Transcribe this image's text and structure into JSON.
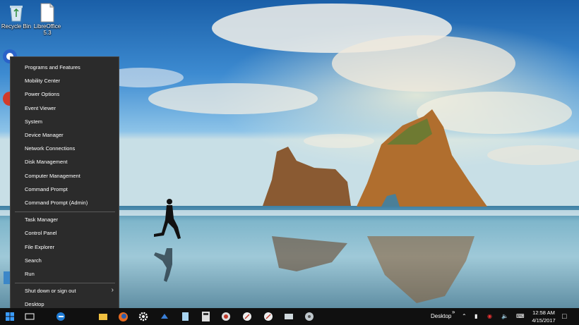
{
  "desktop": {
    "icons": [
      {
        "label": "Recycle Bin",
        "name": "recycle-bin"
      },
      {
        "label": "LibreOffice",
        "label2": "5.3",
        "name": "libreoffice"
      }
    ]
  },
  "context_menu": {
    "groups": [
      [
        "Programs and Features",
        "Mobility Center",
        "Power Options",
        "Event Viewer",
        "System",
        "Device Manager",
        "Network Connections",
        "Disk Management",
        "Computer Management",
        "Command Prompt",
        "Command Prompt (Admin)"
      ],
      [
        "Task Manager",
        "Control Panel",
        "File Explorer",
        "Search",
        "Run"
      ],
      [
        "Shut down or sign out",
        "Desktop"
      ]
    ]
  },
  "taskbar": {
    "desktop_label": "Desktop",
    "clock_time": "12:58 AM",
    "clock_date": "4/15/2017",
    "icons": [
      "start-icon",
      "task-view-icon",
      "edge-icon",
      "file-explorer-icon",
      "firefox-icon",
      "settings-icon",
      "app-icon",
      "notepad-icon",
      "calculator-icon",
      "network-app-icon",
      "safari-icon",
      "safari-icon",
      "drive-icon",
      "disk-icon"
    ]
  },
  "colors": {
    "menu_bg": "#2b2b2b",
    "taskbar_bg": "#101010",
    "accent": "#0078d7"
  }
}
